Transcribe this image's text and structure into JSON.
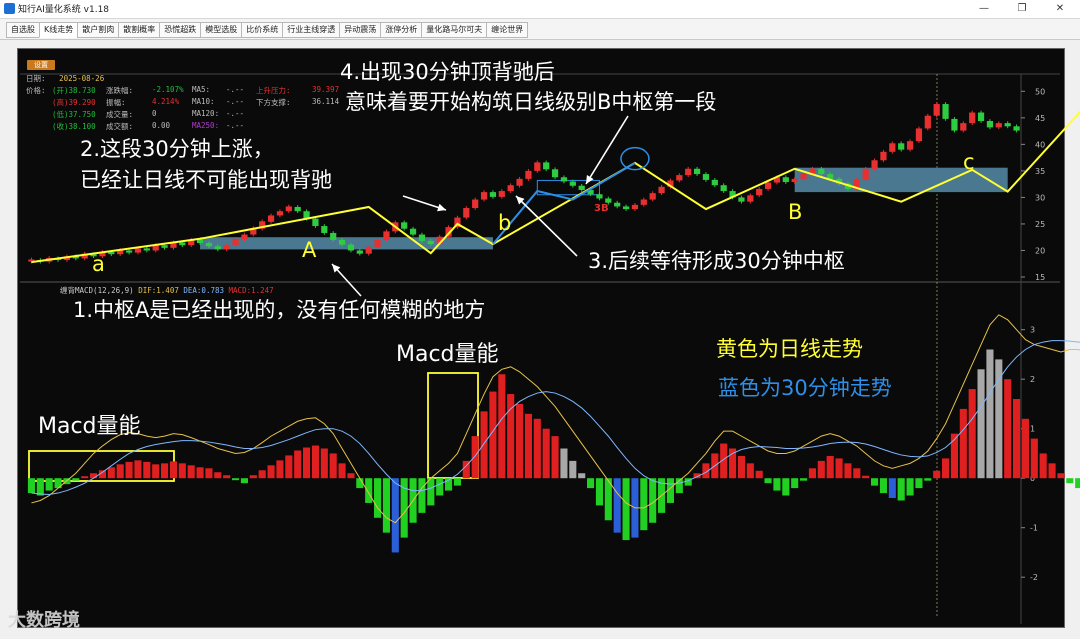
{
  "window": {
    "title": "知行AI量化系统 v1.18",
    "min_icon": "minimize-icon",
    "max_icon": "maximize-icon",
    "close_icon": "close-icon"
  },
  "tabs": [
    "自选股",
    "K线走势",
    "散户割肉",
    "散割概率",
    "恐慌超跌",
    "模型选股",
    "比价系统",
    "行业主线穿透",
    "异动震荡",
    "涨停分析",
    "量化路马尔可夫",
    "缠论世界"
  ],
  "active_tab": 1,
  "settings_label": "设置",
  "info": {
    "date_label": "日期:",
    "date_value": "2025-08-26",
    "price_label": "价格:",
    "open": "(开)38.730",
    "high": "(高)39.290",
    "low": "(低)37.750",
    "close": "(收)38.100",
    "chg_label": "涨跌幅:",
    "chg_value": "-2.107%",
    "amp_label": "振幅:",
    "amp_value": "4.214%",
    "vol_label": "成交量:",
    "vol_value": "0",
    "amt_label": "成交额:",
    "amt_value": "0.00",
    "ma5_label": "MA5:",
    "ma5_value": "-.--",
    "ma10_label": "MA10:",
    "ma10_value": "-.--",
    "ma120_label": "MA120:",
    "ma120_value": "-.--",
    "ma250_label": "MA250:",
    "ma250_value": "-.--",
    "res_label": "上升压力:",
    "res_value": "39.397",
    "sup_label": "下方支撑:",
    "sup_value": "36.114"
  },
  "macd_header": {
    "name": "缠背MACD(12,26,9)",
    "dif": "DIF:1.407",
    "dea": "DEA:0.783",
    "macd": "MACD:1.247"
  },
  "annotations": {
    "a4_line1": "4.出现30分钟顶背驰后",
    "a4_line2": "意味着要开始构筑日线级别B中枢第一段",
    "a2_line1": "2.这段30分钟上涨，",
    "a2_line2": "已经让日线不可能出现背驰",
    "a3": "3.后续等待形成30分钟中枢",
    "a1": "1.中枢A是已经出现的，没有任何模糊的地方",
    "macd_energy_1": "Macd量能",
    "macd_energy_2": "Macd量能",
    "legend_yellow": "黄色为日线走势",
    "legend_blue": "蓝色为30分钟走势",
    "label_a": "a",
    "label_A": "A",
    "label_b": "b",
    "label_B": "B",
    "label_c": "c",
    "label_3b": "3B"
  },
  "watermark": "大数跨境",
  "chart_data": [
    {
      "type": "candlestick",
      "y_ticks": [
        15,
        20,
        25,
        30,
        35,
        40,
        45,
        50
      ],
      "ylim": [
        15,
        51
      ],
      "bars": [
        {
          "o": 17.9,
          "c": 18.3
        },
        {
          "o": 18.2,
          "c": 17.9
        },
        {
          "o": 17.9,
          "c": 18.6
        },
        {
          "o": 18.5,
          "c": 18.2
        },
        {
          "o": 18.2,
          "c": 18.9
        },
        {
          "o": 18.9,
          "c": 18.5
        },
        {
          "o": 18.5,
          "c": 19.4
        },
        {
          "o": 19.3,
          "c": 18.9
        },
        {
          "o": 18.9,
          "c": 19.7
        },
        {
          "o": 19.7,
          "c": 19.3
        },
        {
          "o": 19.3,
          "c": 20.1
        },
        {
          "o": 20.0,
          "c": 19.6
        },
        {
          "o": 19.6,
          "c": 20.4
        },
        {
          "o": 20.4,
          "c": 20.0
        },
        {
          "o": 20.0,
          "c": 21.0
        },
        {
          "o": 21.0,
          "c": 20.5
        },
        {
          "o": 20.5,
          "c": 21.5
        },
        {
          "o": 21.5,
          "c": 21.0
        },
        {
          "o": 21.0,
          "c": 22.0
        },
        {
          "o": 22.0,
          "c": 21.4
        },
        {
          "o": 21.4,
          "c": 20.8
        },
        {
          "o": 20.8,
          "c": 20.2
        },
        {
          "o": 20.2,
          "c": 21.0
        },
        {
          "o": 21.0,
          "c": 22.2
        },
        {
          "o": 22.1,
          "c": 23.0
        },
        {
          "o": 23.0,
          "c": 24.2
        },
        {
          "o": 24.1,
          "c": 25.5
        },
        {
          "o": 25.4,
          "c": 26.6
        },
        {
          "o": 26.6,
          "c": 27.4
        },
        {
          "o": 27.4,
          "c": 28.3
        },
        {
          "o": 28.2,
          "c": 27.4
        },
        {
          "o": 27.4,
          "c": 26.0
        },
        {
          "o": 26.0,
          "c": 24.6
        },
        {
          "o": 24.6,
          "c": 23.3
        },
        {
          "o": 23.3,
          "c": 22.0
        },
        {
          "o": 22.0,
          "c": 21.1
        },
        {
          "o": 21.1,
          "c": 20.0
        },
        {
          "o": 20.0,
          "c": 19.4
        },
        {
          "o": 19.4,
          "c": 20.6
        },
        {
          "o": 20.6,
          "c": 22.0
        },
        {
          "o": 22.0,
          "c": 23.6
        },
        {
          "o": 23.6,
          "c": 25.3
        },
        {
          "o": 25.3,
          "c": 24.1
        },
        {
          "o": 24.1,
          "c": 23.0
        },
        {
          "o": 23.0,
          "c": 21.8
        },
        {
          "o": 21.8,
          "c": 21.2
        },
        {
          "o": 21.2,
          "c": 22.6
        },
        {
          "o": 22.6,
          "c": 24.4
        },
        {
          "o": 24.4,
          "c": 26.2
        },
        {
          "o": 26.2,
          "c": 28.0
        },
        {
          "o": 28.0,
          "c": 29.6
        },
        {
          "o": 29.6,
          "c": 31.0
        },
        {
          "o": 31.0,
          "c": 30.1
        },
        {
          "o": 30.1,
          "c": 31.2
        },
        {
          "o": 31.2,
          "c": 32.3
        },
        {
          "o": 32.2,
          "c": 33.5
        },
        {
          "o": 33.5,
          "c": 35.0
        },
        {
          "o": 35.0,
          "c": 36.6
        },
        {
          "o": 36.6,
          "c": 35.3
        },
        {
          "o": 35.3,
          "c": 33.8
        },
        {
          "o": 33.8,
          "c": 33.0
        },
        {
          "o": 33.0,
          "c": 32.2
        },
        {
          "o": 32.2,
          "c": 31.4
        },
        {
          "o": 31.4,
          "c": 30.6
        },
        {
          "o": 30.6,
          "c": 29.8
        },
        {
          "o": 29.8,
          "c": 29.0
        },
        {
          "o": 29.0,
          "c": 28.3
        },
        {
          "o": 28.3,
          "c": 27.8
        },
        {
          "o": 27.8,
          "c": 28.6
        },
        {
          "o": 28.6,
          "c": 29.6
        },
        {
          "o": 29.6,
          "c": 30.8
        },
        {
          "o": 30.8,
          "c": 32.0
        },
        {
          "o": 32.0,
          "c": 33.2
        },
        {
          "o": 33.2,
          "c": 34.2
        },
        {
          "o": 34.2,
          "c": 35.4
        },
        {
          "o": 35.4,
          "c": 34.4
        },
        {
          "o": 34.4,
          "c": 33.3
        },
        {
          "o": 33.3,
          "c": 32.3
        },
        {
          "o": 32.3,
          "c": 31.2
        },
        {
          "o": 31.2,
          "c": 30.0
        },
        {
          "o": 30.0,
          "c": 29.2
        },
        {
          "o": 29.2,
          "c": 30.4
        },
        {
          "o": 30.4,
          "c": 31.6
        },
        {
          "o": 31.6,
          "c": 32.8
        },
        {
          "o": 32.8,
          "c": 33.8
        },
        {
          "o": 33.8,
          "c": 32.9
        },
        {
          "o": 32.9,
          "c": 33.5
        },
        {
          "o": 33.5,
          "c": 34.6
        },
        {
          "o": 34.6,
          "c": 35.4
        },
        {
          "o": 35.4,
          "c": 34.4
        },
        {
          "o": 34.4,
          "c": 33.5
        },
        {
          "o": 33.5,
          "c": 32.6
        },
        {
          "o": 32.6,
          "c": 31.6
        },
        {
          "o": 31.6,
          "c": 33.4
        },
        {
          "o": 33.4,
          "c": 35.4
        },
        {
          "o": 35.4,
          "c": 37.0
        },
        {
          "o": 37.0,
          "c": 38.6
        },
        {
          "o": 38.6,
          "c": 40.2
        },
        {
          "o": 40.2,
          "c": 39.0
        },
        {
          "o": 39.0,
          "c": 40.6
        },
        {
          "o": 40.6,
          "c": 43.0
        },
        {
          "o": 43.0,
          "c": 45.4
        },
        {
          "o": 45.4,
          "c": 47.6
        },
        {
          "o": 47.6,
          "c": 44.8
        },
        {
          "o": 44.8,
          "c": 42.6
        },
        {
          "o": 42.6,
          "c": 44.0
        },
        {
          "o": 44.0,
          "c": 46.0
        },
        {
          "o": 46.0,
          "c": 44.4
        },
        {
          "o": 44.4,
          "c": 43.2
        },
        {
          "o": 43.2,
          "c": 44.0
        },
        {
          "o": 44.0,
          "c": 43.4
        },
        {
          "o": 43.4,
          "c": 42.6
        }
      ],
      "daily_trend_yellow": [
        [
          0,
          17.8
        ],
        [
          19,
          22.2
        ],
        [
          38,
          28.2
        ],
        [
          45,
          19.5
        ],
        [
          48,
          25.0
        ],
        [
          52,
          21.2
        ],
        [
          68,
          36.5
        ],
        [
          76,
          27.8
        ],
        [
          86,
          35.4
        ],
        [
          98,
          29.2
        ],
        [
          106,
          35.2
        ],
        [
          110,
          31.1
        ],
        [
          120,
          49.5
        ]
      ],
      "min30_trend_blue": [
        [
          52,
          21.2
        ],
        [
          57,
          31.2
        ],
        [
          61,
          29.6
        ],
        [
          68,
          36.5
        ]
      ],
      "zhongshu_A": {
        "x": [
          19,
          52
        ],
        "y": [
          20.2,
          22.5
        ]
      },
      "zhongshu_B": {
        "x": [
          86,
          110
        ],
        "y": [
          31.0,
          35.6
        ]
      },
      "small_box_30m": {
        "x": [
          57,
          64
        ],
        "y": [
          30.5,
          33.2
        ]
      }
    },
    {
      "type": "bar",
      "name": "缠背MACD(12,26,9)",
      "y_ticks": [
        -2,
        -1,
        0,
        1,
        2,
        3
      ],
      "ylim": [
        -2.4,
        3.6
      ],
      "macd_hist": [
        -0.3,
        -0.35,
        -0.25,
        -0.2,
        -0.12,
        -0.05,
        0.04,
        0.1,
        0.16,
        0.22,
        0.28,
        0.33,
        0.36,
        0.33,
        0.28,
        0.3,
        0.34,
        0.3,
        0.26,
        0.22,
        0.2,
        0.12,
        0.06,
        -0.04,
        -0.1,
        0.06,
        0.16,
        0.26,
        0.36,
        0.46,
        0.56,
        0.62,
        0.66,
        0.6,
        0.5,
        0.3,
        0.1,
        -0.2,
        -0.5,
        -0.8,
        -1.1,
        -1.5,
        -1.2,
        -0.9,
        -0.7,
        -0.55,
        -0.35,
        -0.25,
        -0.15,
        0.35,
        0.85,
        1.35,
        1.75,
        2.1,
        1.7,
        1.5,
        1.3,
        1.2,
        1.0,
        0.85,
        0.6,
        0.35,
        0.1,
        -0.2,
        -0.55,
        -0.85,
        -1.1,
        -1.25,
        -1.2,
        -1.05,
        -0.9,
        -0.7,
        -0.5,
        -0.3,
        -0.15,
        0.1,
        0.3,
        0.5,
        0.7,
        0.6,
        0.45,
        0.3,
        0.15,
        -0.1,
        -0.25,
        -0.35,
        -0.2,
        -0.05,
        0.2,
        0.35,
        0.45,
        0.4,
        0.3,
        0.2,
        0.05,
        -0.15,
        -0.3,
        -0.4,
        -0.45,
        -0.35,
        -0.2,
        -0.05,
        0.15,
        0.4,
        0.9,
        1.4,
        1.8,
        2.2,
        2.6,
        2.4,
        2.0,
        1.6,
        1.2,
        0.8,
        0.5,
        0.3,
        0.1,
        -0.1,
        -0.2,
        -0.3
      ],
      "gray_bars": [
        60,
        61,
        62,
        107,
        108,
        109
      ],
      "blue_bars": [
        41,
        66,
        68,
        97
      ],
      "dif": [
        -0.5,
        -0.45,
        -0.35,
        -0.2,
        -0.05,
        0.1,
        0.3,
        0.5,
        0.65,
        0.78,
        0.88,
        0.92,
        0.9,
        0.85,
        0.82,
        0.85,
        0.9,
        0.88,
        0.82,
        0.75,
        0.68,
        0.6,
        0.55,
        0.5,
        0.52,
        0.6,
        0.72,
        0.85,
        0.95,
        1.05,
        1.15,
        1.2,
        1.22,
        1.1,
        0.9,
        0.6,
        0.3,
        0.0,
        -0.3,
        -0.6,
        -0.8,
        -0.9,
        -0.7,
        -0.45,
        -0.2,
        0.0,
        0.15,
        0.3,
        0.5,
        0.9,
        1.3,
        1.7,
        2.05,
        2.2,
        2.25,
        2.15,
        2.0,
        1.85,
        1.65,
        1.45,
        1.2,
        0.95,
        0.7,
        0.45,
        0.2,
        -0.05,
        -0.3,
        -0.5,
        -0.6,
        -0.6,
        -0.5,
        -0.35,
        -0.2,
        -0.05,
        0.1,
        0.3,
        0.5,
        0.75,
        0.95,
        0.95,
        0.85,
        0.75,
        0.65,
        0.55,
        0.5,
        0.5,
        0.55,
        0.65,
        0.75,
        0.85,
        0.9,
        0.85,
        0.75,
        0.65,
        0.5,
        0.35,
        0.25,
        0.2,
        0.25,
        0.3,
        0.4,
        0.55,
        0.8,
        1.1,
        1.5,
        1.9,
        2.3,
        2.7,
        3.1,
        3.3,
        3.2,
        3.0,
        2.8,
        2.7,
        2.65,
        2.6,
        2.55,
        2.6,
        2.6,
        2.5
      ],
      "dea": [
        -0.3,
        -0.32,
        -0.33,
        -0.3,
        -0.25,
        -0.18,
        -0.1,
        0.0,
        0.12,
        0.25,
        0.38,
        0.5,
        0.58,
        0.64,
        0.68,
        0.71,
        0.74,
        0.76,
        0.76,
        0.75,
        0.73,
        0.7,
        0.67,
        0.63,
        0.6,
        0.6,
        0.62,
        0.66,
        0.72,
        0.78,
        0.85,
        0.92,
        0.98,
        1.0,
        1.0,
        0.95,
        0.85,
        0.7,
        0.5,
        0.28,
        0.08,
        -0.1,
        -0.2,
        -0.25,
        -0.25,
        -0.2,
        -0.12,
        -0.04,
        0.08,
        0.25,
        0.45,
        0.7,
        0.95,
        1.2,
        1.4,
        1.55,
        1.65,
        1.72,
        1.75,
        1.72,
        1.65,
        1.55,
        1.42,
        1.25,
        1.05,
        0.85,
        0.62,
        0.4,
        0.2,
        0.05,
        -0.05,
        -0.1,
        -0.12,
        -0.1,
        -0.05,
        0.03,
        0.12,
        0.25,
        0.38,
        0.5,
        0.58,
        0.62,
        0.64,
        0.63,
        0.62,
        0.6,
        0.6,
        0.61,
        0.63,
        0.66,
        0.7,
        0.72,
        0.73,
        0.72,
        0.69,
        0.64,
        0.58,
        0.52,
        0.47,
        0.44,
        0.43,
        0.45,
        0.52,
        0.62,
        0.78,
        0.98,
        1.2,
        1.45,
        1.72,
        2.0,
        2.25,
        2.45,
        2.6,
        2.7,
        2.75,
        2.78,
        2.78,
        2.77,
        2.75,
        2.72
      ]
    }
  ]
}
